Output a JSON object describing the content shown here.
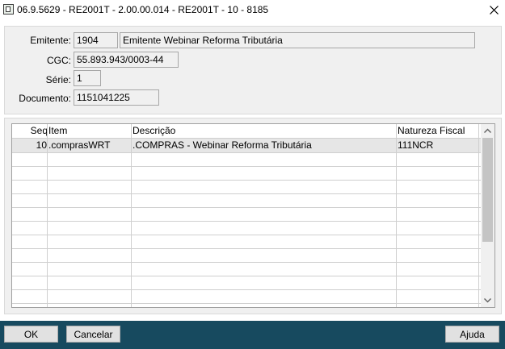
{
  "window": {
    "title": "06.9.5629 - RE2001T - 2.00.00.014 - RE2001T - 10 - 8185"
  },
  "form": {
    "emitente_label": "Emitente:",
    "emitente_code": "1904",
    "emitente_name": "Emitente Webinar Reforma Tributária",
    "cgc_label": "CGC:",
    "cgc_value": "55.893.943/0003-44",
    "serie_label": "Série:",
    "serie_value": "1",
    "documento_label": "Documento:",
    "documento_value": "1151041225"
  },
  "grid": {
    "columns": [
      "Seq",
      "Item",
      "Descrição",
      "Natureza Fiscal"
    ],
    "rows": [
      {
        "seq": "10",
        "item": ".comprasWRT",
        "descricao": ".COMPRAS - Webinar Reforma Tributária",
        "natureza": "111NCR"
      }
    ]
  },
  "buttons": {
    "ok": "OK",
    "cancelar": "Cancelar",
    "ajuda": "Ajuda"
  },
  "icons": {
    "close": "close-icon",
    "app": "window-app-icon",
    "scroll_up": "chevron-up-icon",
    "scroll_down": "chevron-down-icon"
  },
  "colors": {
    "footer": "#174a5f",
    "panel": "#f0f0f0",
    "selected_row": "#e6e6e6"
  }
}
